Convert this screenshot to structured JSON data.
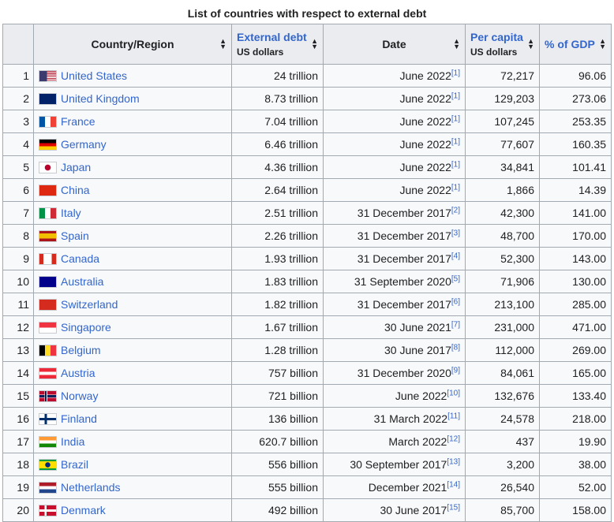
{
  "caption": "List of countries with respect to external debt",
  "headers": {
    "country": "Country/Region",
    "debt_main": "External debt",
    "debt_sub": "US dollars",
    "date": "Date",
    "per_main": "Per capita",
    "per_sub": "US dollars",
    "gdp": "% of GDP"
  },
  "rows": [
    {
      "rank": "1",
      "country": "United States",
      "debt": "24 trillion",
      "date": "June 2022",
      "ref": "[1]",
      "per": "72,217",
      "gdp": "96.06",
      "flag": "us-flag"
    },
    {
      "rank": "2",
      "country": "United Kingdom",
      "debt": "8.73 trillion",
      "date": "June 2022",
      "ref": "[1]",
      "per": "129,203",
      "gdp": "273.06",
      "flag": "uk-flag"
    },
    {
      "rank": "3",
      "country": "France",
      "debt": "7.04 trillion",
      "date": "June 2022",
      "ref": "[1]",
      "per": "107,245",
      "gdp": "253.35",
      "flag": "france-flag"
    },
    {
      "rank": "4",
      "country": "Germany",
      "debt": "6.46 trillion",
      "date": "June 2022",
      "ref": "[1]",
      "per": "77,607",
      "gdp": "160.35",
      "flag": "germany-flag"
    },
    {
      "rank": "5",
      "country": "Japan",
      "debt": "4.36 trillion",
      "date": "June 2022",
      "ref": "[1]",
      "per": "34,841",
      "gdp": "101.41",
      "flag": "japan-flag"
    },
    {
      "rank": "6",
      "country": "China",
      "debt": "2.64 trillion",
      "date": "June 2022",
      "ref": "[1]",
      "per": "1,866",
      "gdp": "14.39",
      "flag": "china-flag"
    },
    {
      "rank": "7",
      "country": "Italy",
      "debt": "2.51 trillion",
      "date": "31 December 2017",
      "ref": "[2]",
      "per": "42,300",
      "gdp": "141.00",
      "flag": "italy-flag"
    },
    {
      "rank": "8",
      "country": "Spain",
      "debt": "2.26 trillion",
      "date": "31 December 2017",
      "ref": "[3]",
      "per": "48,700",
      "gdp": "170.00",
      "flag": "spain-flag"
    },
    {
      "rank": "9",
      "country": "Canada",
      "debt": "1.93 trillion",
      "date": "31 December 2017",
      "ref": "[4]",
      "per": "52,300",
      "gdp": "143.00",
      "flag": "canada-flag"
    },
    {
      "rank": "10",
      "country": "Australia",
      "debt": "1.83 trillion",
      "date": "31 September 2020",
      "ref": "[5]",
      "per": "71,906",
      "gdp": "130.00",
      "flag": "australia-flag"
    },
    {
      "rank": "11",
      "country": "Switzerland",
      "debt": "1.82 trillion",
      "date": "31 December 2017",
      "ref": "[6]",
      "per": "213,100",
      "gdp": "285.00",
      "flag": "switzerland-flag"
    },
    {
      "rank": "12",
      "country": "Singapore",
      "debt": "1.67 trillion",
      "date": "30 June 2021",
      "ref": "[7]",
      "per": "231,000",
      "gdp": "471.00",
      "flag": "singapore-flag"
    },
    {
      "rank": "13",
      "country": "Belgium",
      "debt": "1.28 trillion",
      "date": "30 June 2017",
      "ref": "[8]",
      "per": "112,000",
      "gdp": "269.00",
      "flag": "belgium-flag"
    },
    {
      "rank": "14",
      "country": "Austria",
      "debt": "757 billion",
      "date": "31 December 2020",
      "ref": "[9]",
      "per": "84,061",
      "gdp": "165.00",
      "flag": "austria-flag"
    },
    {
      "rank": "15",
      "country": "Norway",
      "debt": "721 billion",
      "date": "June 2022",
      "ref": "[10]",
      "per": "132,676",
      "gdp": "133.40",
      "flag": "norway-flag"
    },
    {
      "rank": "16",
      "country": "Finland",
      "debt": "136 billion",
      "date": "31 March 2022",
      "ref": "[11]",
      "per": "24,578",
      "gdp": "218.00",
      "flag": "finland-flag"
    },
    {
      "rank": "17",
      "country": "India",
      "debt": "620.7 billion",
      "date": "March 2022",
      "ref": "[12]",
      "per": "437",
      "gdp": "19.90",
      "flag": "india-flag"
    },
    {
      "rank": "18",
      "country": "Brazil",
      "debt": "556 billion",
      "date": "30 September 2017",
      "ref": "[13]",
      "per": "3,200",
      "gdp": "38.00",
      "flag": "brazil-flag"
    },
    {
      "rank": "19",
      "country": "Netherlands",
      "debt": "555 billion",
      "date": "December 2021",
      "ref": "[14]",
      "per": "26,540",
      "gdp": "52.00",
      "flag": "netherlands-flag"
    },
    {
      "rank": "20",
      "country": "Denmark",
      "debt": "492 billion",
      "date": "30 June 2017",
      "ref": "[15]",
      "per": "85,700",
      "gdp": "158.00",
      "flag": "denmark-flag"
    }
  ]
}
